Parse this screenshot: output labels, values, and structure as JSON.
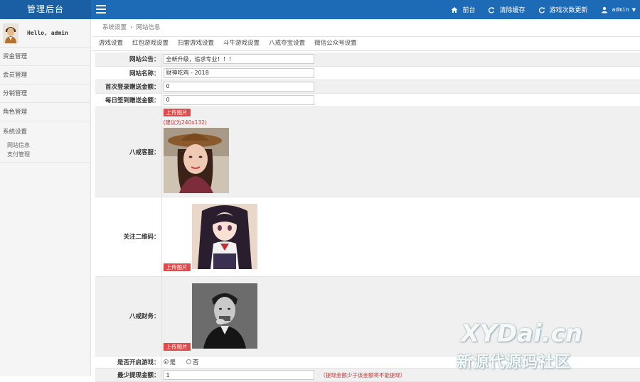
{
  "header": {
    "brand": "管理后台",
    "links": [
      {
        "label": "前台",
        "icon": "home-icon"
      },
      {
        "label": "清除缓存",
        "icon": "refresh-icon"
      },
      {
        "label": "游戏次数更新",
        "icon": "refresh-icon"
      }
    ],
    "user": "admin"
  },
  "sidebar": {
    "greeting": "Hello, admin",
    "items": [
      {
        "label": "资金管理"
      },
      {
        "label": "会员管理"
      },
      {
        "label": "分销管理"
      },
      {
        "label": "角色管理"
      }
    ],
    "group": {
      "label": "系统设置",
      "subitems": [
        "网站信息",
        "支付管理"
      ]
    }
  },
  "breadcrumb": {
    "root": "系统设置",
    "sep": "›",
    "current": "网站信息"
  },
  "tabs": [
    "游戏设置",
    "红包游戏设置",
    "扫雷游戏设置",
    "斗牛游戏设置",
    "八戒夺宝设置",
    "微信公众号设置"
  ],
  "form": {
    "announcement": {
      "label": "网站公告：",
      "value": "全新升级，追求专业！！！"
    },
    "site_name": {
      "label": "网站名称：",
      "value": "财神吃鸡 - 2018"
    },
    "first_login_bonus": {
      "label": "首次登录赠送金额：",
      "value": "0"
    },
    "daily_checkin_bonus": {
      "label": "每日签到赠送金额：",
      "value": "0"
    },
    "service": {
      "label": "八戒客服：",
      "upload": "上传图片",
      "hint": "(建议为240x132)"
    },
    "qrcode": {
      "label": "关注二维码：",
      "upload": "上传图片"
    },
    "finance": {
      "label": "八戒财务：",
      "upload": "上传图片"
    },
    "game_switch": {
      "label": "是否开启游戏：",
      "options": [
        "是",
        "否"
      ],
      "selected": "是"
    },
    "min_withdraw": {
      "label": "最少提现金额：",
      "value": "1",
      "warn": "（提现金额少于该金额将不能提现）"
    }
  },
  "watermark": {
    "line1": "XYDai.cn",
    "line2": "新源代源码社区"
  }
}
